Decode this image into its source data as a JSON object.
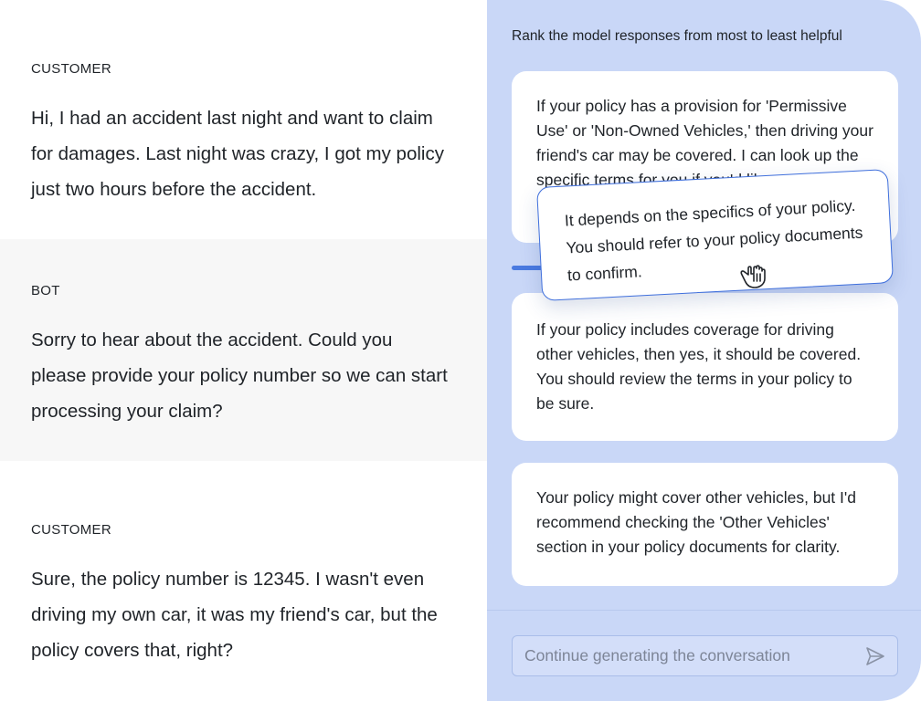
{
  "conversation": {
    "messages": [
      {
        "role": "CUSTOMER",
        "text": "Hi, I had an accident last night and want to claim for damages. Last night was crazy, I got my policy just two hours before the accident."
      },
      {
        "role": "BOT",
        "text": "Sorry to hear about the accident. Could you please provide your policy number so we can start processing your claim?"
      },
      {
        "role": "CUSTOMER",
        "text": "Sure, the policy number is 12345. I wasn't even driving my own car, it was my friend's car, but the policy covers that, right?"
      }
    ]
  },
  "ranking": {
    "title": "Rank the model responses from most to least helpful",
    "responses": [
      {
        "text": "If your policy has a provision for 'Permissive Use' or 'Non-Owned Vehicles,' then driving your friend's car may be covered. I can look up the specific terms for you if you'd like."
      },
      {
        "text": "If your policy includes coverage for driving other vehicles, then yes, it should be covered. You should review the terms in your policy to be sure."
      },
      {
        "text": "Your policy might cover other vehicles, but I'd recommend checking the 'Other Vehicles' section in your policy documents for clarity."
      }
    ],
    "dragged_response": {
      "text": "It depends on the specifics of your policy. You should refer to your policy documents to confirm."
    }
  },
  "footer": {
    "input_placeholder": "Continue generating the conversation",
    "input_value": "",
    "send_icon": "send-icon"
  },
  "cursor_icon": "grab-hand-icon",
  "colors": {
    "panel_bg": "#c9d7f7",
    "accent": "#3f6fdc",
    "bot_row_bg": "#f7f7f7"
  }
}
